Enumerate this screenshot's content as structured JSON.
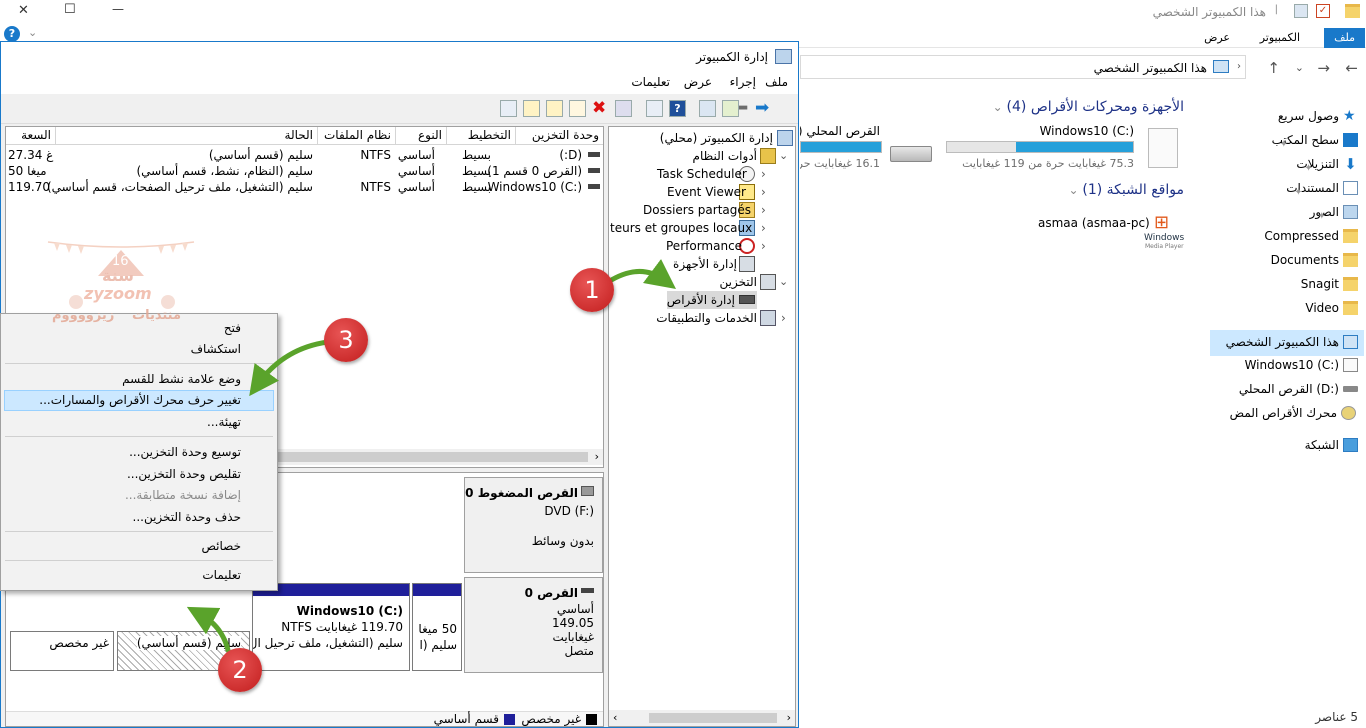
{
  "explorer": {
    "title": "هذا الكمبيوتر الشخصي",
    "window_controls": {
      "close": "✕",
      "maximize": "☐",
      "minimize": "—"
    },
    "ribbon_tabs": {
      "file": "ملف",
      "computer": "الكمبيوتر",
      "view": "عرض"
    },
    "address": "هذا الكمبيوتر الشخصي",
    "sections": {
      "devices": "الأجهزة ومحركات الأقراص (4)",
      "network": "مواقع الشبكة (1)"
    },
    "drives": {
      "c_name": "Windows10 (C:)",
      "c_free": "75.3 غيغابايت حرة من 119 غيغابايت",
      "c_fill": 0.37,
      "d_name": "القرص المحلي (D:)",
      "d_free": "16.1 غيغابايت حرة",
      "d_fill": 0.6
    },
    "network_item": "asmaa (asmaa-pc)",
    "media_player_label_1": "Windows",
    "media_player_label_2": "Media Player",
    "nav": {
      "quick_access": "وصول سريع",
      "desktop": "سطح المكتب",
      "downloads": "التنزيلات",
      "documents_ar": "المستندات",
      "pictures": "الصور",
      "compressed": "Compressed",
      "documents": "Documents",
      "snagit": "Snagit",
      "video": "Video",
      "this_pc": "هذا الكمبيوتر الشخصي",
      "drive_c": "Windows10 (C:)",
      "drive_d": "القرص المحلي (D:)",
      "dvd": "محرك الأقراص المض",
      "network": "الشبكة"
    },
    "status": "5 عناصر"
  },
  "cm": {
    "title": "إدارة الكمبيوتر",
    "menu": {
      "file": "ملف",
      "action": "إجراء",
      "view": "عرض",
      "help": "تعليمات"
    },
    "tree": {
      "root": "إدارة الكمبيوتر (محلي)",
      "system_tools": "أدوات النظام",
      "task_scheduler": "Task Scheduler",
      "event_viewer": "Event Viewer",
      "shared_folders": "Dossiers partagés",
      "local_users": "teurs et groupes locaux",
      "performance": "Performance",
      "device_manager": "إدارة الأجهزة",
      "storage": "التخزين",
      "disk_management": "إدارة الأقراص",
      "services": "الخدمات والتطبيقات"
    },
    "columns": {
      "volume": "وحدة التخزين",
      "layout": "التخطيط",
      "type": "النوع",
      "fs": "نظام الملفات",
      "status": "الحالة",
      "capacity": "السعة"
    },
    "rows": [
      {
        "volume": "(D:)",
        "layout": "بسيط",
        "type": "أساسي",
        "fs": "NTFS",
        "status": "سليم (قسم أساسي)",
        "capacity": "27.34 غ"
      },
      {
        "volume": "(القرص 0 قسم 1)",
        "layout": "بسيط",
        "type": "أساسي",
        "fs": "",
        "status": "سليم (النظام، نشط، قسم أساسي)",
        "capacity": "50 ميغا"
      },
      {
        "volume": "Windows10 (C:)",
        "layout": "بسيط",
        "type": "أساسي",
        "fs": "NTFS",
        "status": "سليم (التشغيل، ملف ترحيل الصفحات، قسم أساسي)",
        "capacity": "119.70"
      }
    ],
    "cdrom": {
      "title": "القرص المضغوط 0",
      "drive": "DVD (F:)",
      "media": "بدون وسائط"
    },
    "disk0": {
      "title": "القرص 0",
      "type": "أساسي",
      "size": "149.05",
      "unit": "غيغابايت",
      "state": "متصل"
    },
    "partitions": {
      "small_size": "50 ميغا",
      "small_status": "سليم (ا",
      "c_name": "Windows10  (C:)",
      "c_size": "119.70 غيغابايت NTFS",
      "c_status": "سليم (التشغيل، ملف ترحيل ال",
      "d_status": "سليم (قسم أساسي)",
      "unalloc": "غير مخصص"
    },
    "legend": {
      "unallocated": "غير مخصص",
      "primary": "قسم أساسي"
    }
  },
  "context_menu": {
    "open": "فتح",
    "explore": "استكشاف",
    "mark_active": "وضع علامة نشط للقسم",
    "change_letter": "تغيير حرف محرك الأقراص والمسارات...",
    "format": "تهيئة...",
    "extend": "توسيع وحدة التخزين...",
    "shrink": "تقليص وحدة التخزين...",
    "add_mirror": "إضافة نسخة متطابقة...",
    "delete": "حذف وحدة التخزين...",
    "properties": "خصائص",
    "help": "تعليمات"
  },
  "steps": {
    "one": "1",
    "two": "2",
    "three": "3"
  },
  "watermark": {
    "years": "16",
    "word": "سنة",
    "brand": "zyzoom",
    "forum": "منتديات",
    "name": "زيزووووم"
  },
  "colors": {
    "accent": "#1979ca",
    "primary_partition": "#1f1f9a",
    "step_badge": "#d32b2b",
    "arrow": "#55a32a",
    "progress": "#26a0da"
  }
}
